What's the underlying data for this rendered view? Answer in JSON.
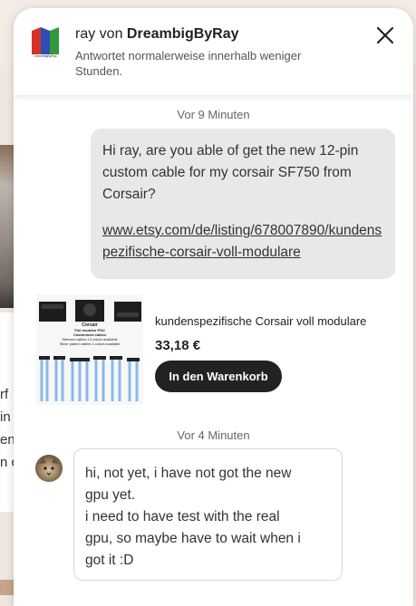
{
  "background": {
    "fragments": [
      "rf",
      "in",
      "en",
      "n c"
    ]
  },
  "header": {
    "name_prefix": "ray von ",
    "shop_name": "DreambigByRay",
    "subtitle": "Antwortet normalerweise innerhalb weniger Stunden.",
    "logo_text": "DreambigByRay",
    "close_icon": "close-icon"
  },
  "messages": {
    "timestamp1": "Vor 9 Minuten",
    "outgoing_text": "Hi ray, are you able of get the new 12-pin custom cable for my corsair SF750 from Corsair?",
    "outgoing_link": "www.etsy.com/de/listing/678007890/kundenspezifische-corsair-voll-modulare",
    "product": {
      "title": "kundenspezifische Corsair voll modulare",
      "price": "33,18 €",
      "cart_button": "In den Warenkorb",
      "image_lines": [
        "Corsair",
        "Full modular PSU",
        "Customized cables",
        "Sleeved cables 13 colors available",
        "Silver plated cables 1 colors available"
      ]
    },
    "timestamp2": "Vor 4 Minuten",
    "incoming_lines": [
      "hi, not yet, i have not got the new",
      "gpu yet.",
      "i need to have test with the real",
      "gpu, so maybe have to wait when i",
      "got it :D"
    ]
  },
  "colors": {
    "panel_bg": "#ffffff",
    "outgoing_bubble": "#e8e8e8",
    "cart_button": "#222222",
    "logo_blue": "#2b4fb5",
    "logo_red": "#d6322a",
    "logo_green": "#2e9a3c"
  }
}
